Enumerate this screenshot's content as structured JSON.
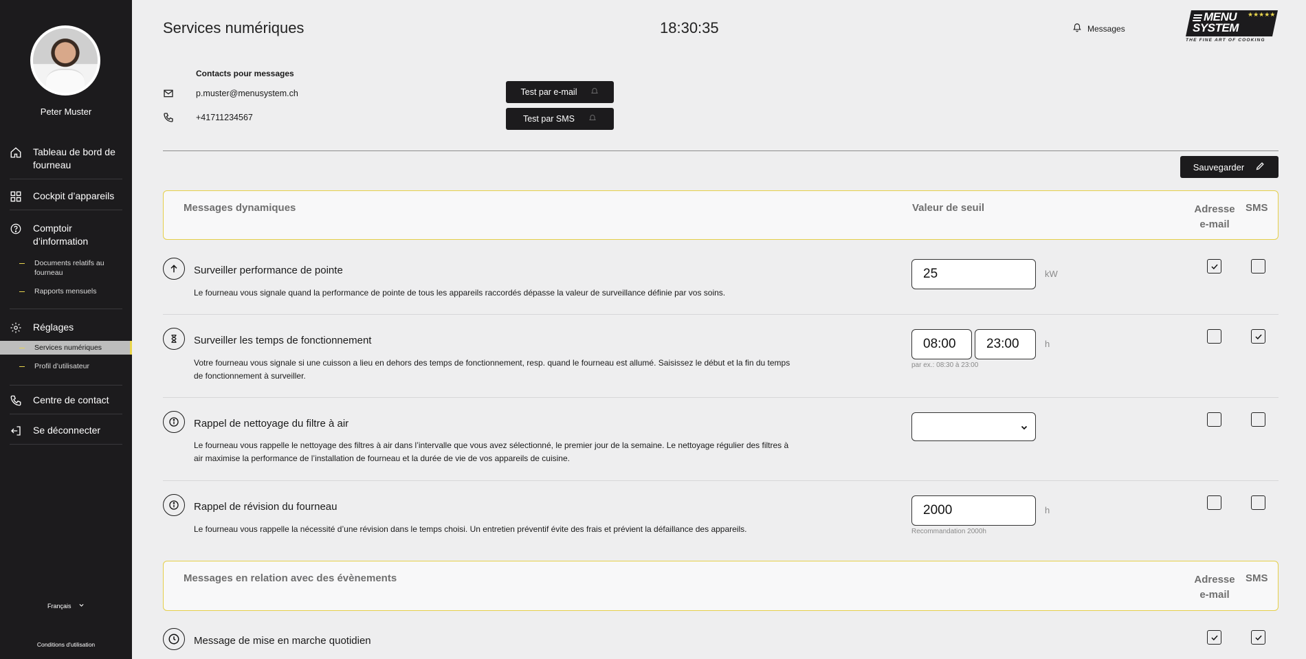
{
  "sidebar": {
    "user_name": "Peter Muster",
    "nav": [
      {
        "label": "Tableau de bord de fourneau",
        "icon": "home-icon"
      },
      {
        "label": "Cockpit d’appareils",
        "icon": "grid-icon"
      },
      {
        "label": "Comptoir d’information",
        "icon": "help-circle-icon"
      },
      {
        "label": "Réglages",
        "icon": "gear-icon"
      },
      {
        "label": "Centre de contact",
        "icon": "phone-icon"
      },
      {
        "label": "Se déconnecter",
        "icon": "logout-icon"
      }
    ],
    "sub_info": [
      "Documents relatifs au fourneau",
      "Rapports mensuels"
    ],
    "sub_settings": [
      "Services numériques",
      "Profil d’utilisateur"
    ],
    "language": "Français",
    "terms": "Conditions d'utilisation"
  },
  "header": {
    "title": "Services numériques",
    "time": "18:30:35",
    "messages_label": "Messages",
    "logo_line1": "MENU",
    "logo_line2": "SYSTEM",
    "logo_stars": "★★★★★",
    "logo_tagline": "THE FINE ART OF COOKING"
  },
  "contacts": {
    "title": "Contacts pour messages",
    "email": "p.muster@menusystem.ch",
    "phone": "+41711234567",
    "test_email_label": "Test par e-mail",
    "test_sms_label": "Test par SMS"
  },
  "save_label": "Sauvegarder",
  "dynamic": {
    "header": "Messages dynamiques",
    "threshold_col": "Valeur de seuil",
    "email_col": "Adresse e-mail",
    "sms_col": "SMS",
    "rows": [
      {
        "icon": "arrow-up-circle-icon",
        "title": "Surveiller performance de pointe",
        "desc": "Le fourneau vous signale quand la performance de pointe de tous les appareils raccordés dépasse la valeur de surveillance définie par vos soins.",
        "value": "25",
        "unit": "kW",
        "email": true,
        "sms": false
      },
      {
        "icon": "hourglass-circle-icon",
        "title": "Surveiller les temps de fonctionnement",
        "desc": "Votre fourneau vous signale si une cuisson a lieu en dehors des temps de fonctionnement, resp. quand le fourneau est allumé. Saisissez le début et la fin du temps de fonctionnement à surveiller.",
        "start": "08:00",
        "end": "23:00",
        "unit": "h",
        "hint": "par ex.: 08:30 à 23:00",
        "email": false,
        "sms": true
      },
      {
        "icon": "info-circle-icon",
        "title": "Rappel de nettoyage du filtre à air",
        "desc": "Le fourneau vous rappelle le nettoyage des filtres à air dans l’intervalle que vous avez sélectionné, le premier jour de la semaine. Le nettoyage régulier des filtres à air maximise la performance de l’installation de fourneau et la durée de vie de vos appareils de cuisine.",
        "selected": "",
        "email": false,
        "sms": false
      },
      {
        "icon": "info-circle-icon",
        "title": "Rappel de révision du fourneau",
        "desc": "Le fourneau vous rappelle la nécessité d’une révision dans le temps choisi. Un entretien préventif évite des frais et prévient la défaillance des appareils.",
        "value": "2000",
        "unit": "h",
        "hint": "Recommandation 2000h",
        "email": false,
        "sms": false
      }
    ]
  },
  "events": {
    "header": "Messages en relation avec des évènements",
    "email_col": "Adresse e-mail",
    "sms_col": "SMS",
    "rows": [
      {
        "icon": "clock-circle-icon",
        "title": "Message de mise en marche quotidien",
        "email": true,
        "sms": true
      }
    ]
  }
}
